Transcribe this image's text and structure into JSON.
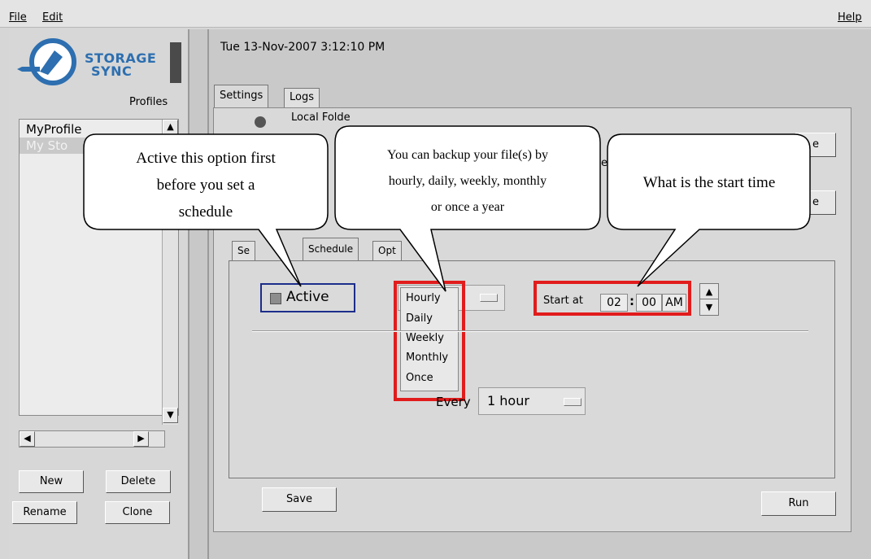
{
  "menu": {
    "file": "File",
    "edit": "Edit",
    "help": "Help"
  },
  "logo": {
    "line1": "STORAGE",
    "line2": "SYNC"
  },
  "profiles": {
    "label": "Profiles",
    "items": [
      {
        "label": "MyProfile",
        "selected": false
      },
      {
        "label": "My Sto",
        "selected": true
      }
    ]
  },
  "left_buttons": {
    "new": "New",
    "delete": "Delete",
    "rename": "Rename",
    "clone": "Clone"
  },
  "datetime": "Tue 13-Nov-2007 3:12:10 PM",
  "tabs": [
    {
      "label": "Settings",
      "active": true
    },
    {
      "label": "Logs",
      "active": false
    }
  ],
  "settings": {
    "local_folder_label": "Local Folde",
    "remote_fragment": "te",
    "browse_fragment_1": "e",
    "browse_fragment_2": "e",
    "fragment_3": "e"
  },
  "subtabs": [
    {
      "label": "Se",
      "active": false
    },
    {
      "label": "Schedule",
      "active": true
    },
    {
      "label": "Opt",
      "active": false
    }
  ],
  "schedule": {
    "active_label": "Active",
    "active_checked": false,
    "frequency_selected": "Hourly",
    "frequency_options": [
      "Hourly",
      "Daily",
      "Weekly",
      "Monthly",
      "Once"
    ],
    "start_label": "Start at",
    "hour": "02",
    "separator": ":",
    "minute": "00",
    "ampm": "AM",
    "every_label": "Every",
    "every_value": "1 hour"
  },
  "buttons": {
    "save": "Save",
    "run": "Run"
  },
  "callouts": {
    "active": {
      "line1": "Active this option first",
      "line2": "before you set a",
      "line3": "schedule"
    },
    "frequency": {
      "line1": "You can backup your file(s) by",
      "line2": "hourly, daily, weekly, monthly",
      "line3": "or once a year"
    },
    "start": {
      "line1": "What is the start time"
    }
  },
  "colors": {
    "highlight": "#e11c1c",
    "active_border": "#1d2d8a",
    "logo": "#2d6fb0"
  }
}
